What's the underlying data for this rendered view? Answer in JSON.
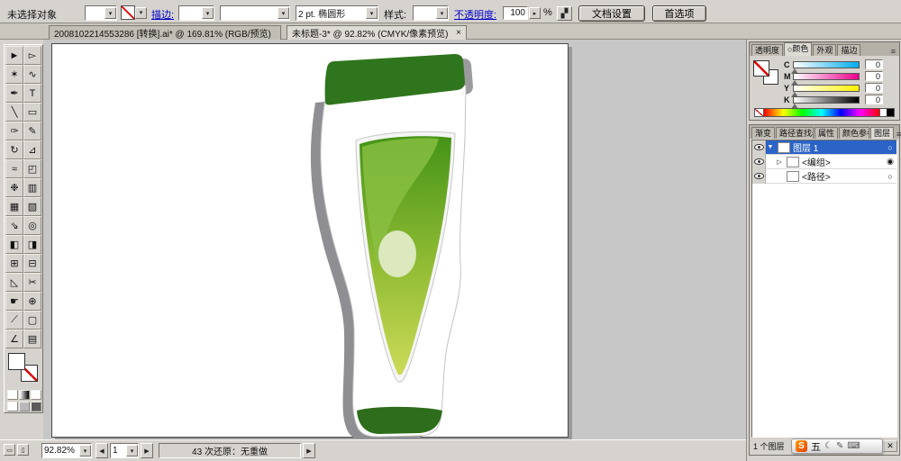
{
  "control_bar": {
    "selection_status": "未选择对象",
    "stroke_link": "描边:",
    "brush_value": "2 pt. 椭圆形",
    "style_label": "样式:",
    "opacity_link": "不透明度:",
    "opacity_value": "100",
    "percent_label": "%",
    "doc_setup_button": "文档设置",
    "preferences_button": "首选项"
  },
  "document_tabs": {
    "tab1_title": "2008102214553286 [转换].ai* @ 169.81% (RGB/预览)",
    "tab2_title": "未标题-3* @ 92.82% (CMYK/像素预览)"
  },
  "toolbox": {
    "tools": [
      {
        "n": "selection-tool",
        "g": "►"
      },
      {
        "n": "direct-selection-tool",
        "g": "▻"
      },
      {
        "n": "magic-wand-tool",
        "g": "✶"
      },
      {
        "n": "lasso-tool",
        "g": "∿"
      },
      {
        "n": "pen-tool",
        "g": "✒"
      },
      {
        "n": "type-tool",
        "g": "T"
      },
      {
        "n": "line-segment-tool",
        "g": "╲"
      },
      {
        "n": "rectangle-tool",
        "g": "▭"
      },
      {
        "n": "paintbrush-tool",
        "g": "✑"
      },
      {
        "n": "pencil-tool",
        "g": "✎"
      },
      {
        "n": "rotate-tool",
        "g": "↻"
      },
      {
        "n": "scale-tool",
        "g": "⊿"
      },
      {
        "n": "warp-tool",
        "g": "≈"
      },
      {
        "n": "free-transform-tool",
        "g": "◰"
      },
      {
        "n": "symbol-sprayer-tool",
        "g": "❉"
      },
      {
        "n": "graph-tool",
        "g": "▥"
      },
      {
        "n": "mesh-tool",
        "g": "▦"
      },
      {
        "n": "gradient-tool",
        "g": "▧"
      },
      {
        "n": "eyedropper-tool",
        "g": "⇘"
      },
      {
        "n": "blend-tool",
        "g": "◎"
      },
      {
        "n": "live-paint-bucket-tool",
        "g": "◧"
      },
      {
        "n": "live-paint-selection-tool",
        "g": "◨"
      },
      {
        "n": "crop-area-tool",
        "g": "⊞"
      },
      {
        "n": "slice-tool",
        "g": "⊟"
      },
      {
        "n": "eraser-tool",
        "g": "◺"
      },
      {
        "n": "scissors-tool",
        "g": "✂"
      },
      {
        "n": "hand-tool",
        "g": "☛"
      },
      {
        "n": "zoom-tool",
        "g": "⊕"
      },
      {
        "n": "knife-tool",
        "g": "⟋"
      },
      {
        "n": "artboard-tool",
        "g": "▢"
      },
      {
        "n": "measure-tool",
        "g": "∠"
      },
      {
        "n": "page-tool",
        "g": "▤"
      }
    ]
  },
  "color_panel": {
    "tab_transparency": "透明度",
    "tab_color": "颜色",
    "tab_appearance": "外观",
    "tab_stroke": "描边",
    "channels": [
      {
        "label": "C",
        "value": "0"
      },
      {
        "label": "M",
        "value": "0"
      },
      {
        "label": "Y",
        "value": "0"
      },
      {
        "label": "K",
        "value": "0"
      }
    ]
  },
  "layers_panel": {
    "tab_gradient": "渐变",
    "tab_pathfinder": "路径查找器",
    "tab_attributes": "属性",
    "tab_color_guide": "颜色参考",
    "tab_layers": "图层",
    "rows": [
      {
        "name": "图层 1",
        "target": "○"
      },
      {
        "name": "<编组>",
        "target": "◉"
      },
      {
        "name": "<路径>",
        "target": "○"
      }
    ],
    "footer_count": "1 个图层"
  },
  "status_bar": {
    "zoom": "92.82%",
    "artboard_number": "1",
    "undo_status": "43 次还原：无重做"
  },
  "ime_bar": {
    "logo": "S",
    "mode": "五",
    "moon": "☾",
    "pen": "✎",
    "keyboard": "⌨"
  },
  "icons": {
    "dropdown": "▾",
    "spinner": "▸",
    "prev": "◀",
    "next": "▶",
    "play": "▶",
    "close": "×",
    "menu": "≡",
    "expand_down": "▼",
    "expand_right": "▷",
    "color_tab_icon": "◇",
    "graph_style": "▞",
    "corner_a": "▭",
    "corner_b": "▯",
    "new_layer": "▣",
    "delete": "✕"
  }
}
